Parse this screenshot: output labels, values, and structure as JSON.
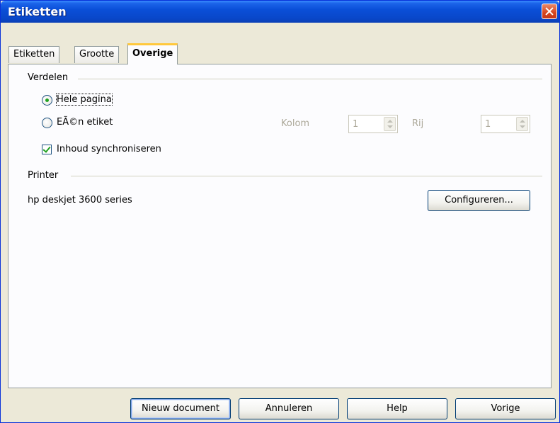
{
  "window": {
    "title": "Etiketten"
  },
  "tabs": [
    {
      "label": "Etiketten",
      "active": false
    },
    {
      "label": "Grootte",
      "active": false
    },
    {
      "label": "Overige",
      "active": true
    }
  ],
  "verdelen": {
    "section_label": "Verdelen",
    "options": [
      {
        "label": "Hele pagina",
        "checked": true
      },
      {
        "label": "EÃ©n etiket",
        "checked": false
      }
    ],
    "kolom_label": "Kolom",
    "kolom_value": "1",
    "rij_label": "Rij",
    "rij_value": "1",
    "sync_label": "Inhoud synchroniseren",
    "sync_checked": true
  },
  "printer": {
    "section_label": "Printer",
    "name": "hp deskjet 3600 series",
    "configure_label": "Configureren..."
  },
  "buttons": {
    "new_document": "Nieuw document",
    "cancel": "Annuleren",
    "help": "Help",
    "previous": "Vorige"
  },
  "colors": {
    "titlebar": "#0a4fd8",
    "dialog_bg": "#ece9d8",
    "panel_bg": "#fcfcfe",
    "active_tab_accent": "#ffc83c",
    "check_mark": "#21a121"
  }
}
